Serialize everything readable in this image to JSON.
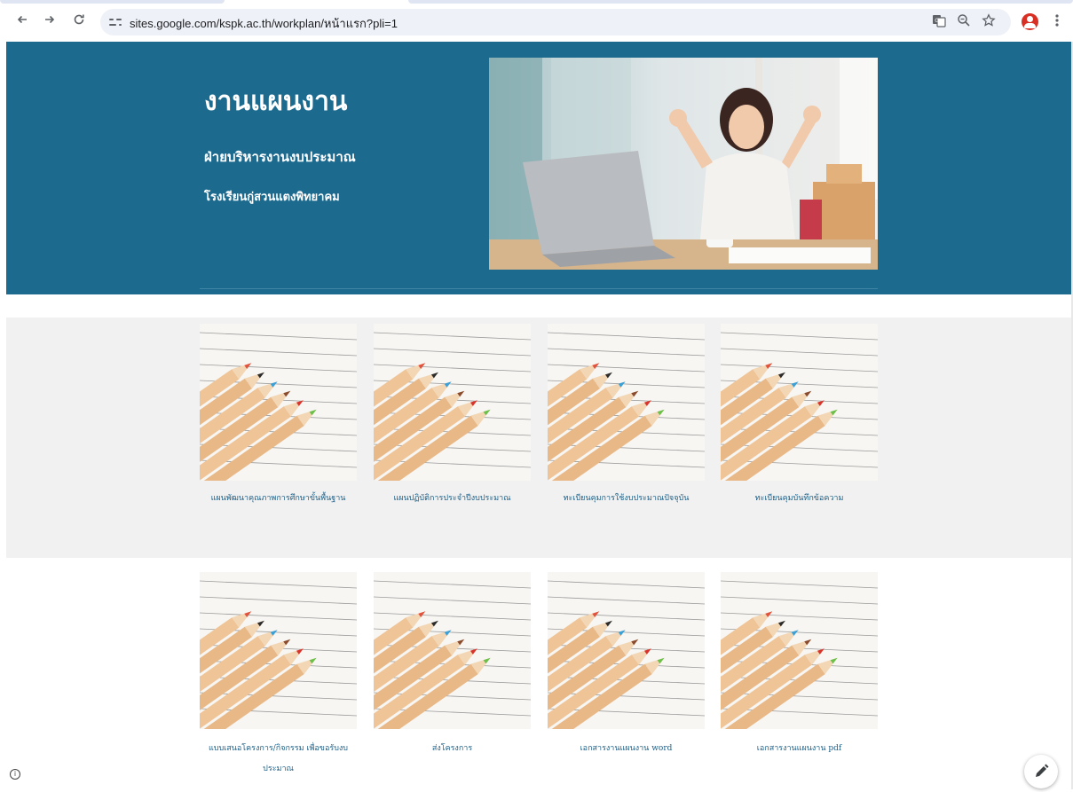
{
  "browser": {
    "url": "sites.google.com/kspk.ac.th/workplan/หน้าแรก?pli=1",
    "icons": {
      "back": "arrow-left-icon",
      "forward": "arrow-right-icon",
      "reload": "reload-icon",
      "site_info": "tune-icon",
      "translate": "translate-icon",
      "zoom": "zoom-icon",
      "bookmark": "star-icon",
      "profile": "avatar-icon",
      "menu": "kebab-menu-icon"
    }
  },
  "hero": {
    "title": "งานแผนงาน",
    "subtitle": "ฝ่ายบริหารงานงบประมาณ",
    "school": "โรงเรียนกู่สวนแตงพิทยาคม",
    "background_color": "#1d6a8f"
  },
  "cards_row1": [
    {
      "label": "แผนพัฒนาคุณภาพการศึกษาขั้นพื้นฐาน"
    },
    {
      "label": "แผนปฏิบัติการประจำปีงบประมาณ"
    },
    {
      "label": "ทะเบียนคุมการใช้งบประมาณปัจจุบัน"
    },
    {
      "label": "ทะเบียนคุมบันทึกข้อความ"
    }
  ],
  "cards_row2": [
    {
      "label": "แบบเสนอโครงการ/กิจกรรม เพื่อขอรับงบประมาณ"
    },
    {
      "label": "ส่งโครงการ"
    },
    {
      "label": "เอกสารงานแผนงาน word"
    },
    {
      "label": "เอกสารงานแผนงาน pdf"
    }
  ],
  "footer": {
    "info_icon": "info-icon",
    "edit_icon": "pencil-icon"
  },
  "colors": {
    "accent": "#1d6a8f",
    "card_label": "#1d5f86",
    "section_gray": "#f1f1f1"
  }
}
